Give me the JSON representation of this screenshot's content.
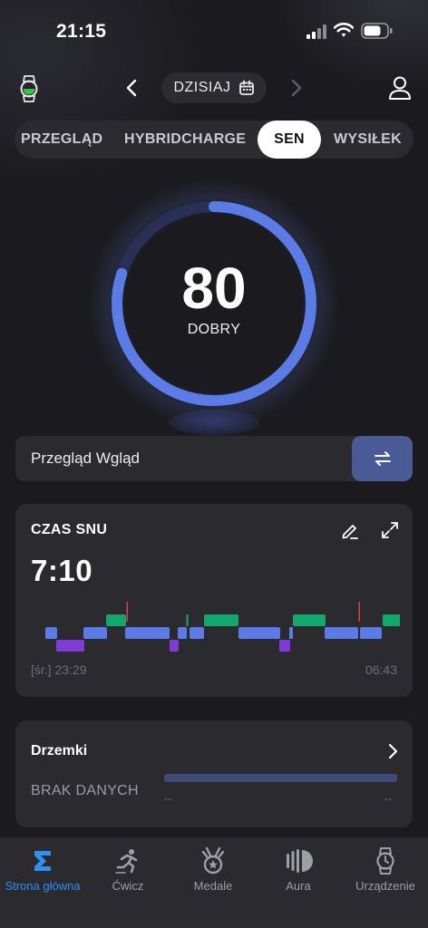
{
  "status_bar": {
    "time": "21:15"
  },
  "header": {
    "date_label": "DZISIAJ"
  },
  "tabs": [
    {
      "label": "PRZEGLĄD",
      "active": false
    },
    {
      "label": "HYBRIDCHARGE",
      "active": false
    },
    {
      "label": "SEN",
      "active": true
    },
    {
      "label": "WYSIŁEK",
      "active": false
    }
  ],
  "score": {
    "value": "80",
    "label": "DOBRY",
    "progress": 0.8
  },
  "insight": {
    "label": "Przegląd Wgląd"
  },
  "sleep_time": {
    "title": "CZAS SNU",
    "duration": "7:10",
    "start": "[śr.] 23:29",
    "end": "06:43"
  },
  "naps": {
    "title": "Drzemki",
    "no_data": "BRAK DANYCH",
    "start_dash": "--",
    "end_dash": "--"
  },
  "bottom_nav": [
    {
      "label": "Strona główna",
      "icon": "sigma-icon",
      "active": true
    },
    {
      "label": "Ćwicz",
      "icon": "running-icon",
      "active": false
    },
    {
      "label": "Medale",
      "icon": "medal-icon",
      "active": false
    },
    {
      "label": "Aura",
      "icon": "aura-icon",
      "active": false
    },
    {
      "label": "Urządzenie",
      "icon": "watch-icon",
      "active": false
    }
  ],
  "colors": {
    "accent_blue": "#2f8ff5",
    "ring": "#5b7be6",
    "stage_light": "#5b7be6",
    "stage_deep": "#7f3bd8",
    "stage_rem": "#12a86b",
    "stage_awake": "#e0413a"
  }
}
